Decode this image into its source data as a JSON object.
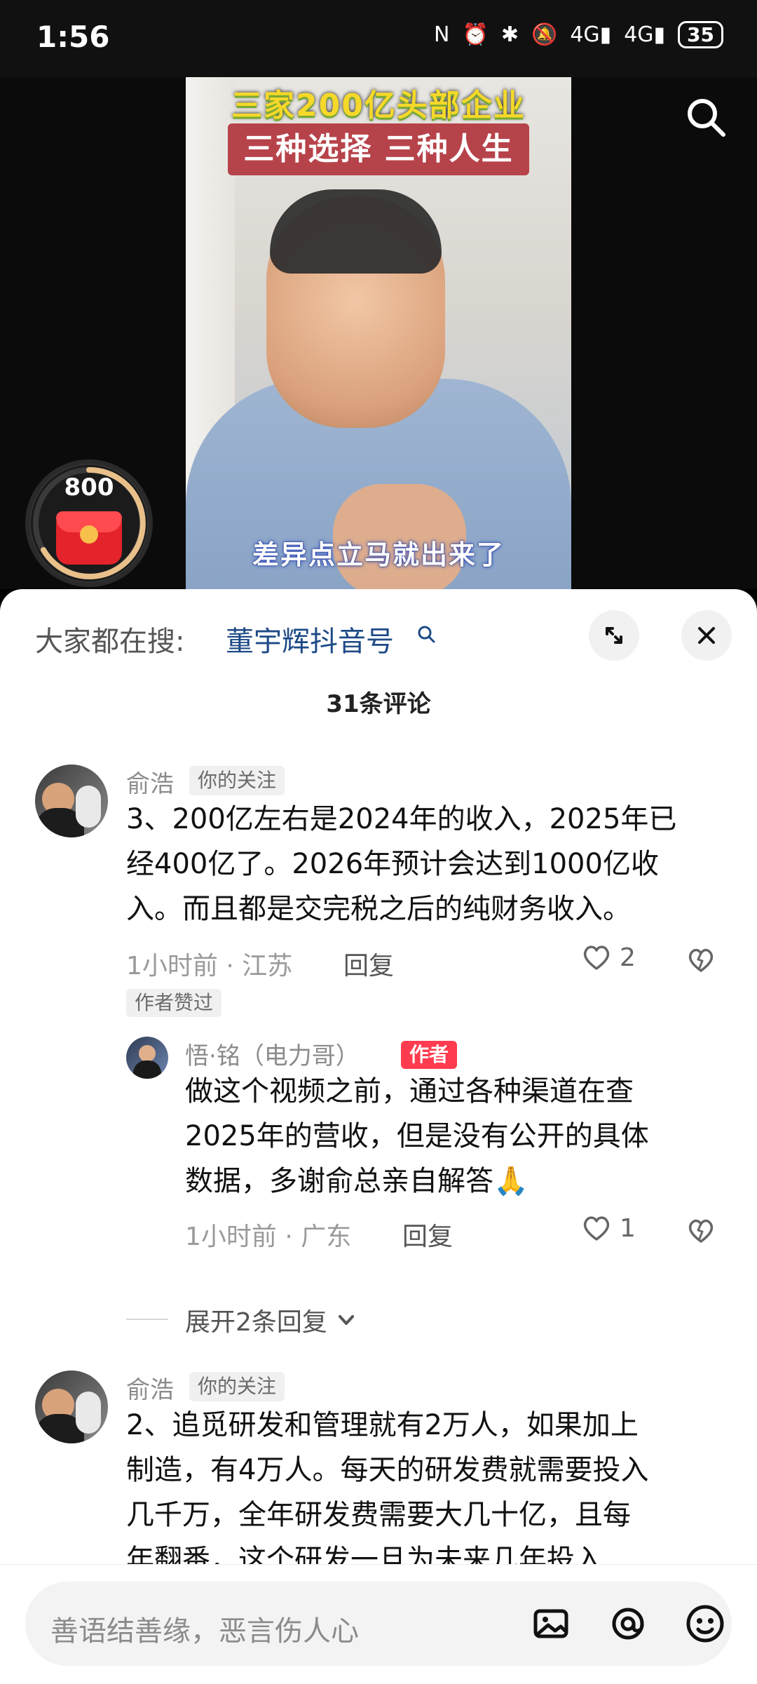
{
  "status_bar": {
    "time": "1:56",
    "icons": [
      "nfc-icon",
      "alarm-icon",
      "bluetooth-icon",
      "mute-icon",
      "signal-4g-icon",
      "signal-4g-icon"
    ],
    "battery": "35"
  },
  "video": {
    "title_line1": "三家200亿头部企业",
    "title_line2": "三种选择 三种人生",
    "subtitle": "差异点立马就出来了"
  },
  "coins": {
    "count": "800"
  },
  "sheet": {
    "search_prefix": "大家都在搜:",
    "search_link": "董宇辉抖音号",
    "comment_count": "31条评论"
  },
  "comments": [
    {
      "username": "俞浩",
      "tag": "你的关注",
      "text_lines": [
        "3、200亿左右是2024年的收入，2025年已",
        "经400亿了。2026年预计会达到1000亿收",
        "入。而且都是交完税之后的纯财务收入。"
      ],
      "time": "1小时前",
      "location": "江苏",
      "reply_label": "回复",
      "likes": "2",
      "author_liked": "作者赞过"
    },
    {
      "username": "悟·铭（电力哥）",
      "tag": "作者",
      "text_lines": [
        "做这个视频之前，通过各种渠道在查",
        "2025年的营收，但是没有公开的具体",
        "数据，多谢俞总亲自解答🙏"
      ],
      "time": "1小时前",
      "location": "广东",
      "reply_label": "回复",
      "likes": "1"
    },
    {
      "username": "俞浩",
      "tag": "你的关注",
      "text_lines": [
        "2、追觅研发和管理就有2万人，如果加上",
        "制造，有4万人。每天的研发费就需要投入",
        "几千万，全年研发费需要大几十亿，且每",
        "年翻番，这个研发一旦为未来几年投入..."
      ]
    }
  ],
  "expand_replies": "展开2条回复",
  "bottom": {
    "placeholder": "善语结善缘，恶言伤人心"
  }
}
